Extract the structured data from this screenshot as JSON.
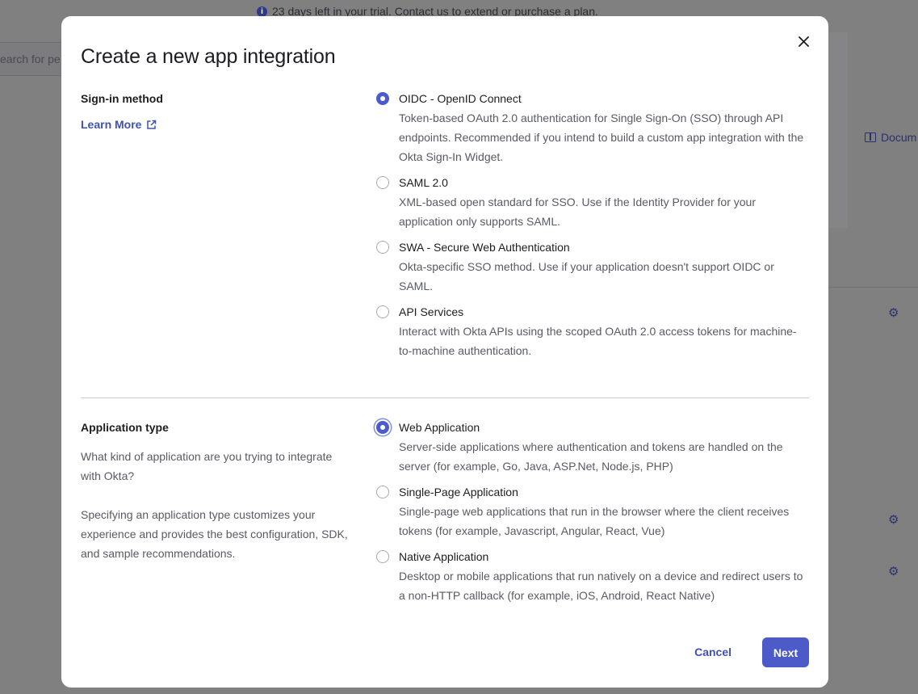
{
  "background": {
    "banner_text": "23 days left in your trial. Contact us to extend or purchase a plan.",
    "search_placeholder": "earch for pe",
    "doc_link": "Docum"
  },
  "modal": {
    "title": "Create a new app integration",
    "close_label": "Close",
    "sign_in": {
      "label": "Sign-in method",
      "learn_more": "Learn More",
      "options": [
        {
          "label": "OIDC - OpenID Connect",
          "desc": "Token-based OAuth 2.0 authentication for Single Sign-On (SSO) through API endpoints. Recommended if you intend to build a custom app integration with the Okta Sign-In Widget.",
          "checked": true
        },
        {
          "label": "SAML 2.0",
          "desc": "XML-based open standard for SSO. Use if the Identity Provider for your application only supports SAML.",
          "checked": false
        },
        {
          "label": "SWA - Secure Web Authentication",
          "desc": "Okta-specific SSO method. Use if your application doesn't support OIDC or SAML.",
          "checked": false
        },
        {
          "label": "API Services",
          "desc": "Interact with Okta APIs using the scoped OAuth 2.0 access tokens for machine-to-machine authentication.",
          "checked": false
        }
      ]
    },
    "app_type": {
      "label": "Application type",
      "desc_1": "What kind of application are you trying to integrate with Okta?",
      "desc_2": "Specifying an application type customizes your experience and provides the best configuration, SDK, and sample recommendations.",
      "options": [
        {
          "label": "Web Application",
          "desc": "Server-side applications where authentication and tokens are handled on the server (for example, Go, Java, ASP.Net, Node.js, PHP)",
          "checked": true
        },
        {
          "label": "Single-Page Application",
          "desc": "Single-page web applications that run in the browser where the client receives tokens (for example, Javascript, Angular, React, Vue)",
          "checked": false
        },
        {
          "label": "Native Application",
          "desc": "Desktop or mobile applications that run natively on a device and redirect users to a non-HTTP callback (for example, iOS, Android, React Native)",
          "checked": false
        }
      ]
    },
    "cancel_label": "Cancel",
    "next_label": "Next"
  },
  "colors": {
    "accent": "#4b5bcd",
    "link": "#4051b5",
    "overlay": "#808080"
  }
}
